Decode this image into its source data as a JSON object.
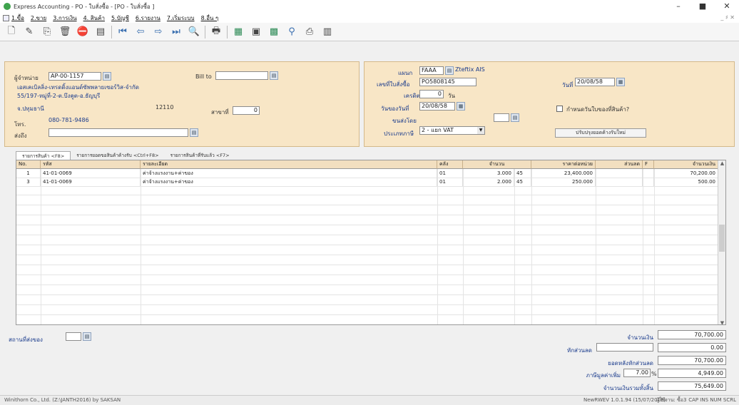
{
  "window": {
    "title": "Express Accounting - PO - ใบสั่งซื้อ        - [PO - ใบสั่งซื้อ       ]",
    "controls": [
      "–",
      "■",
      "✕"
    ]
  },
  "menu": {
    "items": [
      "1.ขื้อ",
      "2.ขาย",
      "3.การเงิน",
      "4. สินค้า",
      "5.บัญชี",
      "6.รายงาน",
      "7.เริ่มระบบ",
      "8.อื่น ๆ"
    ],
    "right": "_ ♯ ✕"
  },
  "toolbar": {
    "icons": [
      "new-doc-icon",
      "edit-icon",
      "copy-icon",
      "delete-icon",
      "cancel-icon",
      "save-icon",
      "first-icon",
      "prev-icon",
      "next-icon",
      "last-icon",
      "search-icon",
      "print-icon",
      "export-icon",
      "calc-icon",
      "attach-icon",
      "person-icon",
      "printer-icon",
      "book-icon"
    ]
  },
  "header_left": {
    "vendor_label": "ผู้จำหน่าย",
    "vendor_code": "AP-00-1157",
    "vendor_name": "เอสเคเบิลลิ่ง-เทรดดิ้งแอนด์ซัพพลายเซอร์วิส-จำกัด",
    "address1": "55/197-หมู่ที่-2-ต.บึงคูต-อ.ธัญบุรี",
    "address2": "จ.ปทุมธานี",
    "postcode": "12110",
    "phone_label": "โทร.",
    "phone": "080-781-9486",
    "ship_label": "ส่งถึง",
    "ship_value": "",
    "bill_label": "Bill to",
    "bill_value": "",
    "branch_label": "สาขาที่",
    "branch_value": "0"
  },
  "header_right": {
    "dept_label": "แผนก",
    "dept_code": "FAAA",
    "dept_name": "Zteftix AIS",
    "po_label": "เลขที่ใบสั่งซื้อ",
    "po_number": "PO5808145",
    "date_label": "วันที่",
    "date_value": "20/08/58",
    "credit_label": "เครดิต",
    "credit_value": "0",
    "credit_unit": "วัน",
    "receive_label": "วันของวันที่",
    "receive_date": "20/08/58",
    "ship_by_label": "ขนส่งโดย",
    "ship_by_value": "",
    "vat_label": "ประเภทภาษี",
    "vat_value": "2 - แยก VAT",
    "checkbox_label": "กำหนดวันใบของที่สินค้า?",
    "update_button": "ปรับปรุงยอดค้างรับใหม่"
  },
  "tabs": [
    "รายการสินค้า <F8>",
    "รายการยอดขอสินค้าค้างรับ <Ctrl+F8>",
    "รายการสินค้าที่รับแล้ว <F7>"
  ],
  "grid": {
    "columns": [
      "No.",
      "รหัส",
      "รายละเอียด",
      "คลัง",
      "จำนวน",
      "ราคาต่อหน่วย",
      "ส่วนลด",
      "F",
      "จำนวนเงิน"
    ],
    "rows": [
      {
        "no": "1",
        "code": "41-01-0069",
        "desc": "ค่าจ้างแรงงาน+ค่าของ",
        "wh": "01",
        "qty": "3.000",
        "unit": "45",
        "price": "23,400.000",
        "disc": "",
        "f": "",
        "amount": "70,200.00"
      },
      {
        "no": "3",
        "code": "41-01-0069",
        "desc": "ค่าจ้างแรงงาน+ค่าของ",
        "wh": "01",
        "qty": "2.000",
        "unit": "45",
        "price": "250.000",
        "disc": "",
        "f": "",
        "amount": "500.00"
      }
    ]
  },
  "footer": {
    "delivery_label": "สถานที่ส่งของ",
    "delivery_value": "",
    "totals": [
      {
        "label": "จำนวนเงิน",
        "value": "70,700.00"
      },
      {
        "label": "หักส่วนลด",
        "value": "0.00"
      },
      {
        "label": "ยอดหลังหักส่วนลด",
        "value": "70,700.00"
      },
      {
        "label": "ภาษีมูลค่าเพิ่ม",
        "value": "4,949.00"
      },
      {
        "label": "จำนวนเงินรวมทั้งสิ้น",
        "value": "75,649.00"
      }
    ],
    "vat_rate": "7.00",
    "vat_pct": "%"
  },
  "status": {
    "left": "Winithorn Co., Ltd. (Z:\\JANTH2016) by SAKSAN",
    "mid": "NewRWEV 1.0.1.94 (15/07/2016)",
    "user": "ผู้ใช้งาน: ซื้อ3",
    "right": "CAP  INS  NUM  SCRL"
  }
}
